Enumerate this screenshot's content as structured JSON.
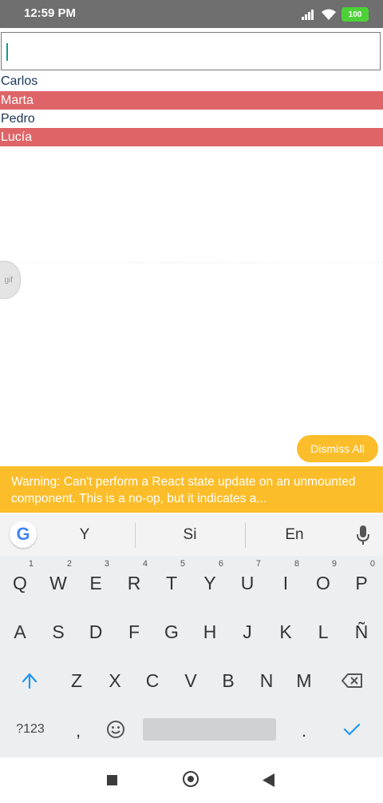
{
  "status_bar": {
    "time": "12:59 PM",
    "battery": "100"
  },
  "input": {
    "value": ""
  },
  "list": [
    {
      "label": "Carlos",
      "highlighted": false
    },
    {
      "label": "Marta",
      "highlighted": true
    },
    {
      "label": "Pedro",
      "highlighted": false
    },
    {
      "label": "Lucía",
      "highlighted": true
    }
  ],
  "gif_label": "gif",
  "dismiss_label": "Dismiss All",
  "warning_text": "Warning: Can't perform a React state update on an unmounted component. This is a no-op, but it indicates a...",
  "keyboard": {
    "suggestions": [
      "Y",
      "Si",
      "En"
    ],
    "row1": [
      {
        "k": "Q",
        "h": "1"
      },
      {
        "k": "W",
        "h": "2"
      },
      {
        "k": "E",
        "h": "3"
      },
      {
        "k": "R",
        "h": "4"
      },
      {
        "k": "T",
        "h": "5"
      },
      {
        "k": "Y",
        "h": "6"
      },
      {
        "k": "U",
        "h": "7"
      },
      {
        "k": "I",
        "h": "8"
      },
      {
        "k": "O",
        "h": "9"
      },
      {
        "k": "P",
        "h": "0"
      }
    ],
    "row2": [
      "A",
      "S",
      "D",
      "F",
      "G",
      "H",
      "J",
      "K",
      "L",
      "Ñ"
    ],
    "row3": [
      "Z",
      "X",
      "C",
      "V",
      "B",
      "N",
      "M"
    ],
    "symbols_label": "?123",
    "comma": ",",
    "period": "."
  },
  "colors": {
    "accent": "#fbbd2a",
    "highlight_row": "#de6468",
    "name_text": "#1d3557",
    "status_bar": "#6f6f6f"
  }
}
